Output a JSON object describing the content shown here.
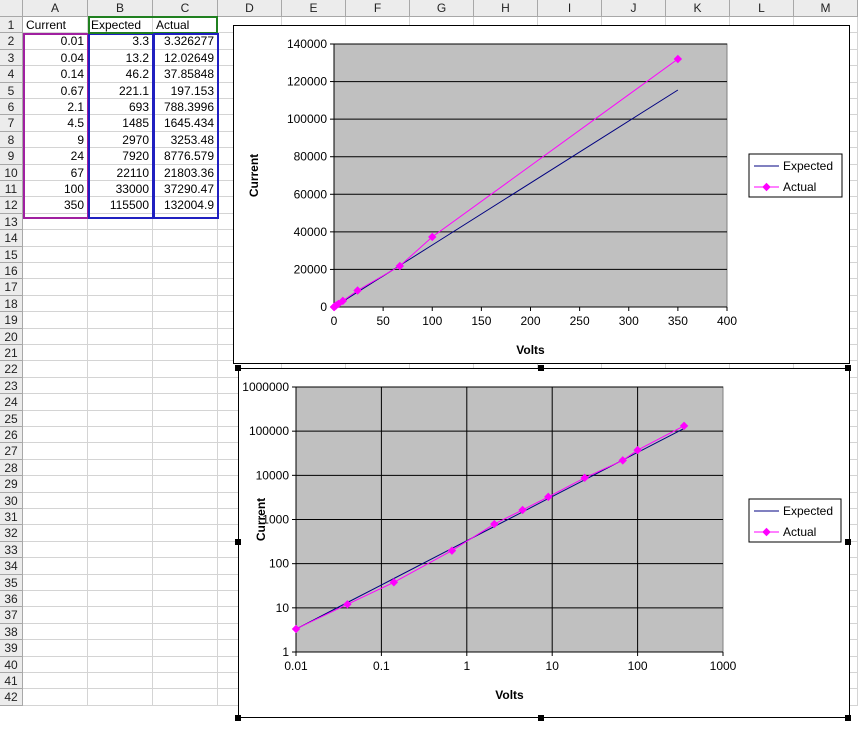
{
  "columns": [
    "A",
    "B",
    "C",
    "D",
    "E",
    "F",
    "G",
    "H",
    "I",
    "J",
    "K",
    "L",
    "M"
  ],
  "rows_count": 42,
  "table": {
    "headers": [
      "Current",
      "Expected",
      "Actual"
    ],
    "rows": [
      [
        "0.01",
        "3.3",
        "3.326277"
      ],
      [
        "0.04",
        "13.2",
        "12.02649"
      ],
      [
        "0.14",
        "46.2",
        "37.85848"
      ],
      [
        "0.67",
        "221.1",
        "197.153"
      ],
      [
        "2.1",
        "693",
        "788.3996"
      ],
      [
        "4.5",
        "1485",
        "1645.434"
      ],
      [
        "9",
        "2970",
        "3253.48"
      ],
      [
        "24",
        "7920",
        "8776.579"
      ],
      [
        "67",
        "22110",
        "21803.36"
      ],
      [
        "100",
        "33000",
        "37290.47"
      ],
      [
        "350",
        "115500",
        "132004.9"
      ]
    ]
  },
  "colors": {
    "expected": "#000080",
    "actual": "#ff00ff",
    "plot_bg": "#c0c0c0"
  },
  "chart_data": [
    {
      "type": "scatter",
      "xlabel": "Volts",
      "ylabel": "Current",
      "xlim": [
        0,
        400
      ],
      "ylim": [
        0,
        140000
      ],
      "x_ticks": [
        "0",
        "50",
        "100",
        "150",
        "200",
        "250",
        "300",
        "350",
        "400"
      ],
      "y_ticks": [
        "0",
        "20000",
        "40000",
        "60000",
        "80000",
        "100000",
        "120000",
        "140000"
      ],
      "grid": "horizontal",
      "legend_position": "right",
      "series": [
        {
          "name": "Expected",
          "marker": "none",
          "x": [
            0.01,
            0.04,
            0.14,
            0.67,
            2.1,
            4.5,
            9,
            24,
            67,
            100,
            350
          ],
          "y": [
            3.3,
            13.2,
            46.2,
            221.1,
            693,
            1485,
            2970,
            7920,
            22110,
            33000,
            115500
          ]
        },
        {
          "name": "Actual",
          "marker": "diamond",
          "x": [
            0.01,
            0.04,
            0.14,
            0.67,
            2.1,
            4.5,
            9,
            24,
            67,
            100,
            350
          ],
          "y": [
            3.326277,
            12.02649,
            37.85848,
            197.153,
            788.3996,
            1645.434,
            3253.48,
            8776.579,
            21803.36,
            37290.47,
            132004.9
          ]
        }
      ]
    },
    {
      "type": "scatter",
      "scale": "log-log",
      "xlabel": "Volts",
      "ylabel": "Current",
      "xlim": [
        0.01,
        1000
      ],
      "ylim": [
        1,
        1000000
      ],
      "x_ticks": [
        "0.01",
        "0.1",
        "1",
        "10",
        "100",
        "1000"
      ],
      "y_ticks": [
        "1",
        "10",
        "100",
        "1000",
        "10000",
        "100000",
        "1000000"
      ],
      "grid": "both",
      "legend_position": "right",
      "series": [
        {
          "name": "Expected",
          "marker": "none",
          "x": [
            0.01,
            0.04,
            0.14,
            0.67,
            2.1,
            4.5,
            9,
            24,
            67,
            100,
            350
          ],
          "y": [
            3.3,
            13.2,
            46.2,
            221.1,
            693,
            1485,
            2970,
            7920,
            22110,
            33000,
            115500
          ]
        },
        {
          "name": "Actual",
          "marker": "diamond",
          "x": [
            0.01,
            0.04,
            0.14,
            0.67,
            2.1,
            4.5,
            9,
            24,
            67,
            100,
            350
          ],
          "y": [
            3.326277,
            12.02649,
            37.85848,
            197.153,
            788.3996,
            1645.434,
            3253.48,
            8776.579,
            21803.36,
            37290.47,
            132004.9
          ]
        }
      ]
    }
  ]
}
